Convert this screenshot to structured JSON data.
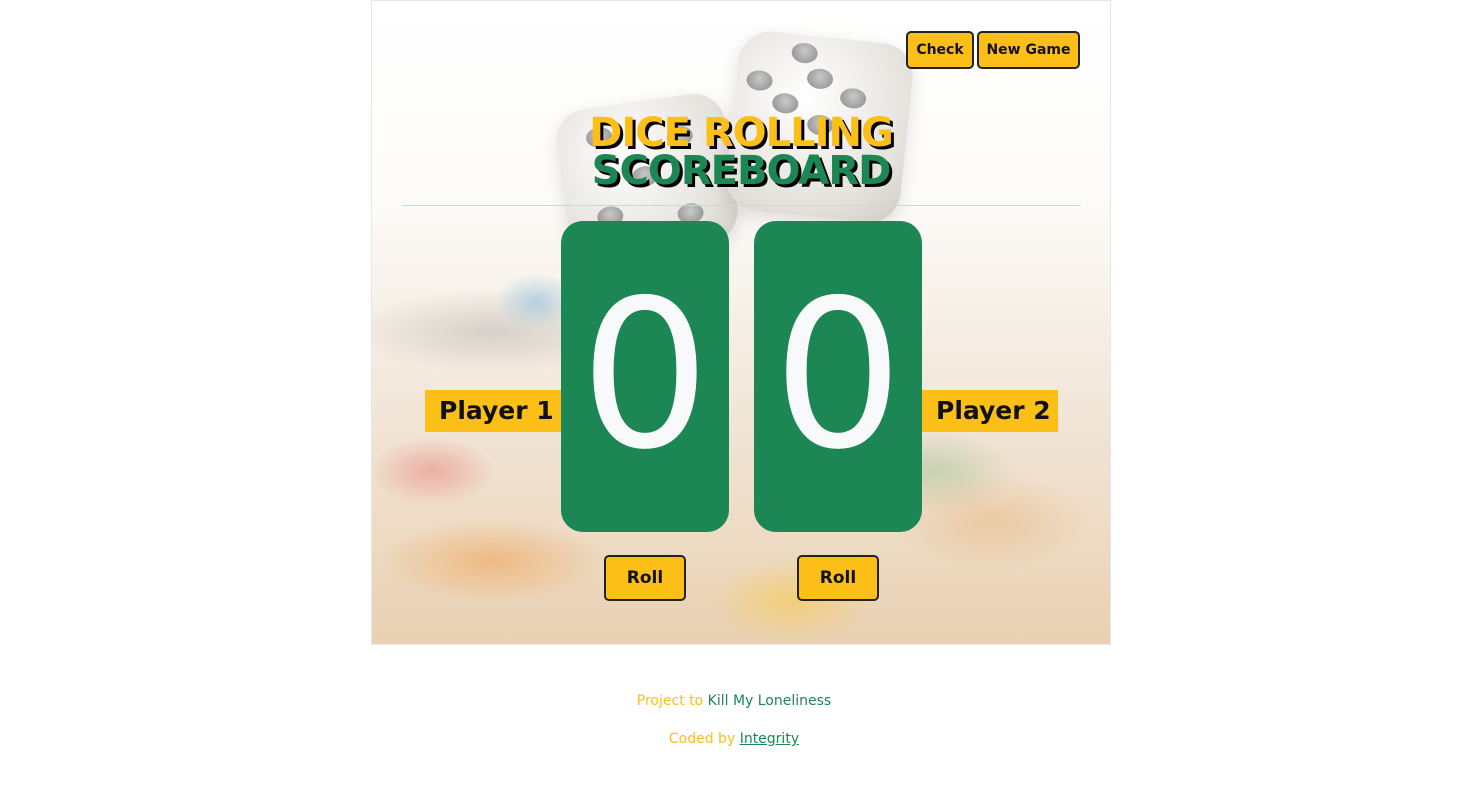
{
  "toolbar": {
    "check_label": "Check",
    "new_game_label": "New Game"
  },
  "title": {
    "line1": "DICE ROLLING",
    "line2": "SCOREBOARD"
  },
  "players": [
    {
      "name": "Player 1",
      "score": "0",
      "roll_label": "Roll"
    },
    {
      "name": "Player 2",
      "score": "0",
      "roll_label": "Roll"
    }
  ],
  "footer": {
    "project_prefix": "Project to",
    "project_name": "Kill My Loneliness",
    "coded_prefix": "Coded by",
    "coded_name": "Integrity"
  },
  "colors": {
    "accent": "#fcbf17",
    "brand_green": "#1c8754"
  },
  "icons": {
    "background": "dice-background-image"
  }
}
